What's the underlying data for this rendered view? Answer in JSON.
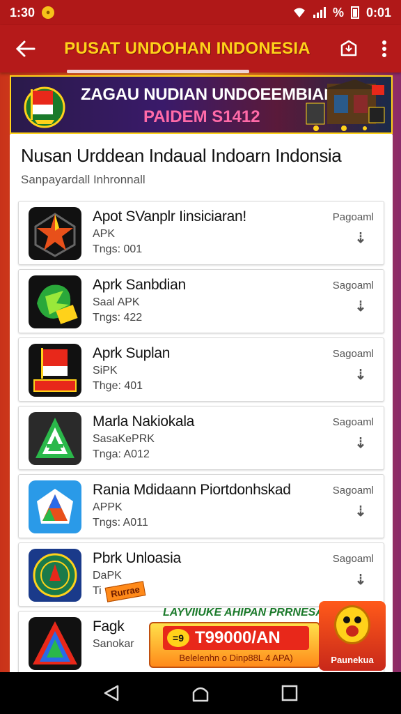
{
  "status_bar": {
    "time": "1:30",
    "battery_text": "%",
    "right_time": "0:01"
  },
  "app_bar": {
    "title": "PUSAT UNDOHAN INDONESIA"
  },
  "banner": {
    "line1": "ZAGAU NUDIAN UNDOEEMBIAN",
    "line2": "PAIDEM S1412"
  },
  "page": {
    "title": "Nusan Urddean Indaual Indoarn Indonsia",
    "subtitle": "Sanpayardall Inhronnall"
  },
  "apps": [
    {
      "name": "Apot SVanplr Iinsiciaran!",
      "type": "APK",
      "size": "Tngs: 001",
      "action": "Pagoaml"
    },
    {
      "name": "Aprk Sanbdian",
      "type": "Saal APK",
      "size": "Tngs: 422",
      "action": "Sagoaml"
    },
    {
      "name": "Aprk Suplan",
      "type": "SiPK",
      "size": "Thge: 401",
      "action": "Sagoaml"
    },
    {
      "name": "Marla Nakiokala",
      "type": "SasaKePRK",
      "size": "Tnga: A012",
      "action": "Sagoaml"
    },
    {
      "name": "Rania Mdidaann Piortdonhskad",
      "type": "APPK",
      "size": "Tngs: A011",
      "action": "Sagoaml"
    },
    {
      "name": "Pbrk Unloasia",
      "type": "DaPK",
      "size": "Ti",
      "action": "Sagoaml"
    },
    {
      "name": "Fagk",
      "type": "Sanokar",
      "size": "",
      "action": ""
    }
  ],
  "ad": {
    "badge": "Rurrae",
    "headline": "LAYVIIUKE AHIPAN PRRNESAA",
    "price": "T99000/AN",
    "coin_label": "=9",
    "sub": "Belelenhn o Dinp88L 4 APA)",
    "cta_label": "Paunekua"
  },
  "colors": {
    "app_bar": "#b51a1a",
    "title": "#ffd21a",
    "status_bar": "#b01818"
  }
}
